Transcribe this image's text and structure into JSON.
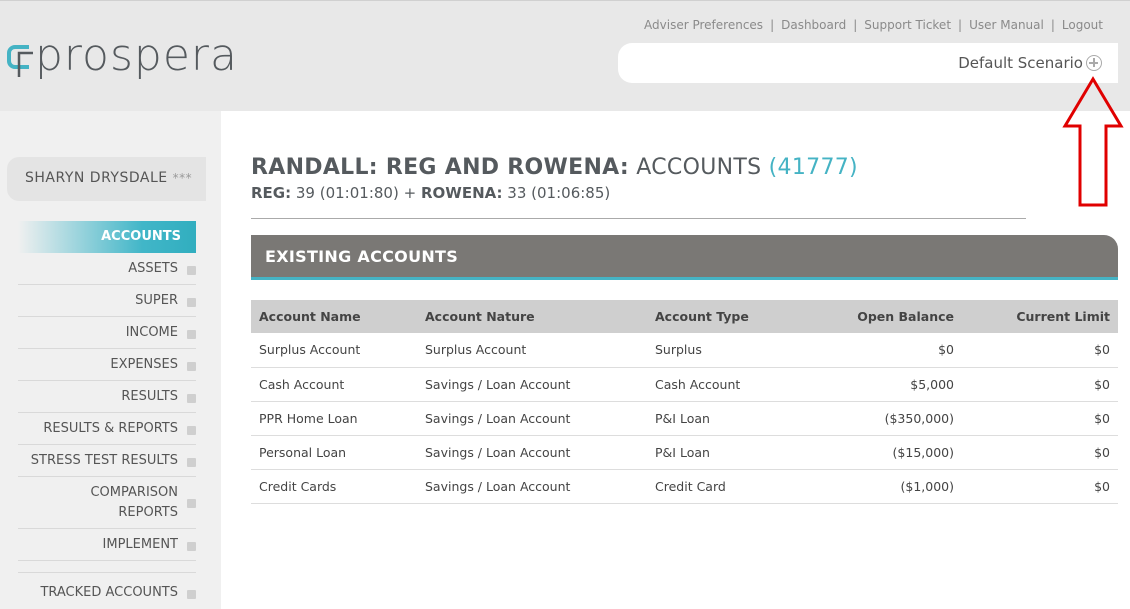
{
  "brand": {
    "logo_text": "prospera"
  },
  "top_links": [
    "Adviser Preferences",
    "Dashboard",
    "Support Ticket",
    "User Manual",
    "Logout"
  ],
  "scenario": {
    "label": "Default Scenario"
  },
  "client": {
    "name": "SHARYN DRYSDALE",
    "stars": "***"
  },
  "nav": {
    "accounts": "ACCOUNTS",
    "assets": "ASSETS",
    "super": "SUPER",
    "income": "INCOME",
    "expenses": "EXPENSES",
    "results": "RESULTS",
    "results_reports": "RESULTS & REPORTS",
    "stress_test": "STRESS TEST RESULTS",
    "comparison_line1": "COMPARISON",
    "comparison_line2": "REPORTS",
    "implement": "IMPLEMENT",
    "tracked": "TRACKED ACCOUNTS"
  },
  "page": {
    "title_bold": "RANDALL: REG AND ROWENA:",
    "title_rest": "ACCOUNTS",
    "title_num": "(41777)",
    "sub_name1": "REG:",
    "sub_val1": "39 (01:01:80)",
    "sub_plus": "+",
    "sub_name2": "ROWENA:",
    "sub_val2": "33 (01:06:85)"
  },
  "section": {
    "title": "EXISTING ACCOUNTS"
  },
  "table": {
    "headers": [
      "Account Name",
      "Account Nature",
      "Account Type",
      "Open Balance",
      "Current Limit"
    ],
    "rows": [
      [
        "Surplus Account",
        "Surplus Account",
        "Surplus",
        "$0",
        "$0"
      ],
      [
        "Cash Account",
        "Savings / Loan Account",
        "Cash Account",
        "$5,000",
        "$0"
      ],
      [
        "PPR Home Loan",
        "Savings / Loan Account",
        "P&I Loan",
        "($350,000)",
        "$0"
      ],
      [
        "Personal Loan",
        "Savings / Loan Account",
        "P&I Loan",
        "($15,000)",
        "$0"
      ],
      [
        "Credit Cards",
        "Savings / Loan Account",
        "Credit Card",
        "($1,000)",
        "$0"
      ]
    ]
  },
  "colors": {
    "accent": "#45b3c4",
    "section_bar": "#7a7875",
    "arrow": "#e00000"
  },
  "icons": {
    "scenario_add": "plus-circle-icon",
    "annotation": "arrow-up-annotation-icon"
  }
}
